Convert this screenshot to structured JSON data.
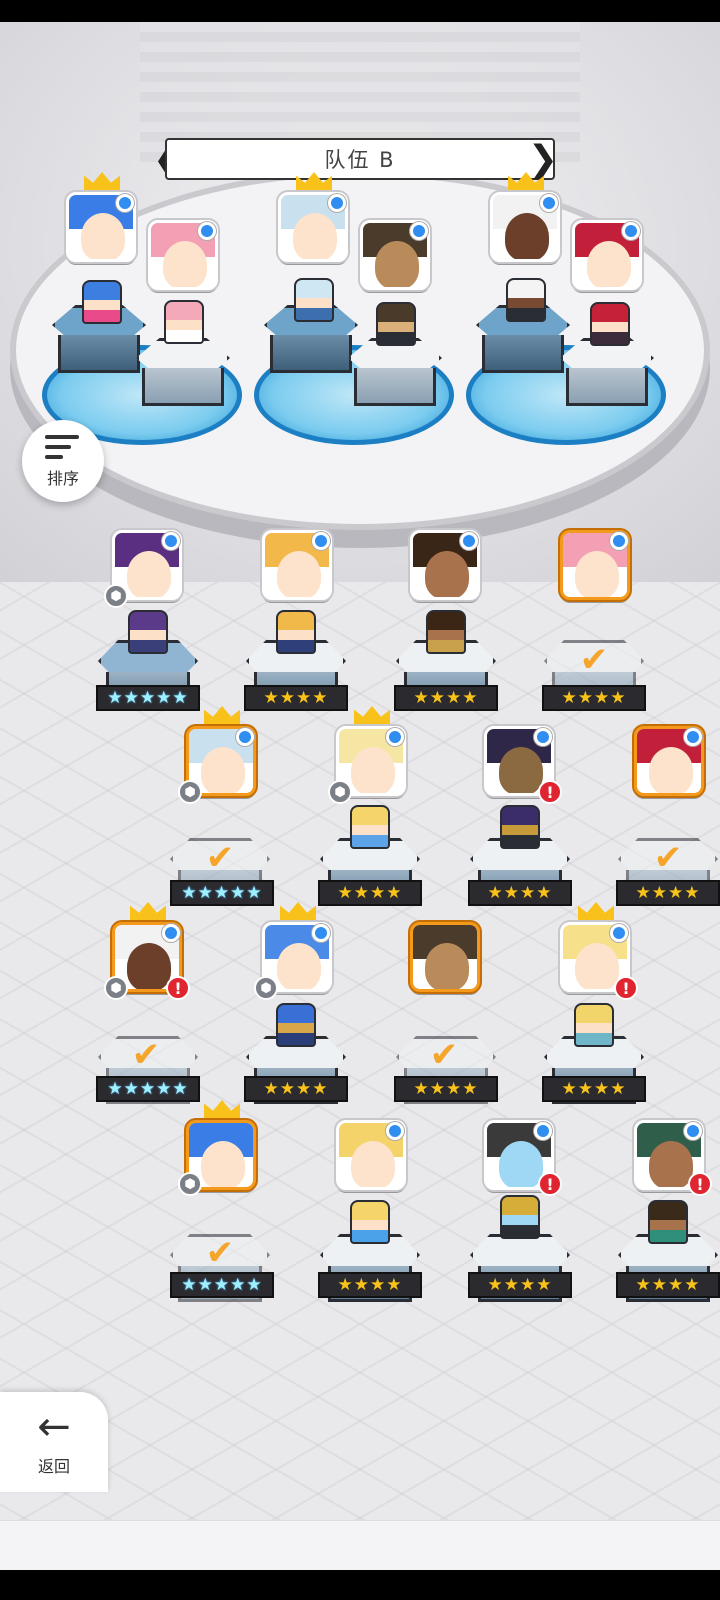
{
  "header": {
    "team_title": "队伍 B",
    "prev_icon": "chevron-left-icon",
    "next_icon": "chevron-right-icon"
  },
  "formation": {
    "slots": [
      {
        "slot": 1,
        "members": [
          "blue-hair-leader",
          "pink-hair-maid"
        ]
      },
      {
        "slot": 2,
        "members": [
          "silver-hair-leader",
          "dark-hooded-rogue"
        ]
      },
      {
        "slot": 3,
        "members": [
          "white-hair-leader",
          "red-hair-fighter"
        ]
      }
    ]
  },
  "sort_button": {
    "label": "排序",
    "icon": "sort-descending-icon"
  },
  "back_button": {
    "label": "返回",
    "icon": "arrow-left-icon"
  },
  "roster": {
    "rows": [
      [
        {
          "name": "purple-hair-mage",
          "stars": "★★★★★",
          "tier": "5-rainbow",
          "in_team": false,
          "crown": false,
          "alert": false,
          "cube": true
        },
        {
          "name": "blonde-knight",
          "stars": "★★★★",
          "tier": "4",
          "in_team": false,
          "crown": false,
          "alert": false,
          "cube": false
        },
        {
          "name": "braided-dancer",
          "stars": "★★★★",
          "tier": "4",
          "in_team": false,
          "crown": false,
          "alert": false,
          "cube": false
        },
        {
          "name": "pink-hair-maid",
          "stars": "★★★★",
          "tier": "4",
          "in_team": true,
          "crown": false,
          "alert": false,
          "cube": false
        }
      ],
      [
        {
          "name": "silver-hair-leader",
          "stars": "★★★★★",
          "tier": "5-rainbow",
          "in_team": true,
          "crown": true,
          "alert": false,
          "cube": true
        },
        {
          "name": "blonde-princess",
          "stars": "★★★★",
          "tier": "4",
          "in_team": false,
          "crown": true,
          "alert": false,
          "cube": true
        },
        {
          "name": "masked-warrior",
          "stars": "★★★★",
          "tier": "4",
          "in_team": false,
          "crown": false,
          "alert": true,
          "cube": false
        },
        {
          "name": "red-hair-fighter",
          "stars": "★★★★",
          "tier": "4",
          "in_team": true,
          "crown": false,
          "alert": false,
          "cube": false
        }
      ],
      [
        {
          "name": "white-hair-leader",
          "stars": "★★★★★",
          "tier": "5-rainbow",
          "in_team": true,
          "crown": true,
          "alert": true,
          "cube": true
        },
        {
          "name": "blue-hair-witch",
          "stars": "★★★★",
          "tier": "4",
          "in_team": false,
          "crown": true,
          "alert": false,
          "cube": true
        },
        {
          "name": "dark-hooded-rogue",
          "stars": "★★★★",
          "tier": "4",
          "in_team": true,
          "crown": false,
          "alert": false,
          "cube": false
        },
        {
          "name": "teal-hair-healer",
          "stars": "★★★★",
          "tier": "4",
          "in_team": false,
          "crown": true,
          "alert": true,
          "cube": false
        }
      ],
      [
        {
          "name": "blue-hair-leader",
          "stars": "★★★★★",
          "tier": "5-rainbow",
          "in_team": true,
          "crown": true,
          "alert": false,
          "cube": true
        },
        {
          "name": "blonde-archer",
          "stars": "★★★★",
          "tier": "4",
          "in_team": false,
          "crown": false,
          "alert": false,
          "cube": false
        },
        {
          "name": "gold-helmet-knight",
          "stars": "★★★★",
          "tier": "4",
          "in_team": false,
          "crown": false,
          "alert": true,
          "cube": false
        },
        {
          "name": "dark-skin-ranger",
          "stars": "★★★★",
          "tier": "4",
          "in_team": false,
          "crown": false,
          "alert": true,
          "cube": false
        }
      ]
    ]
  },
  "colors": {
    "accent_orange": "#f39a1d",
    "star_gold": "#f8c21a",
    "rainbow_star": "#9ff0ff",
    "dot_blue": "#2f8ef0",
    "alert_red": "#e02530",
    "pad_blue": "#1d7fc3"
  },
  "glyphs": {
    "alert": "!",
    "check": "✔",
    "cube": "⬢"
  }
}
